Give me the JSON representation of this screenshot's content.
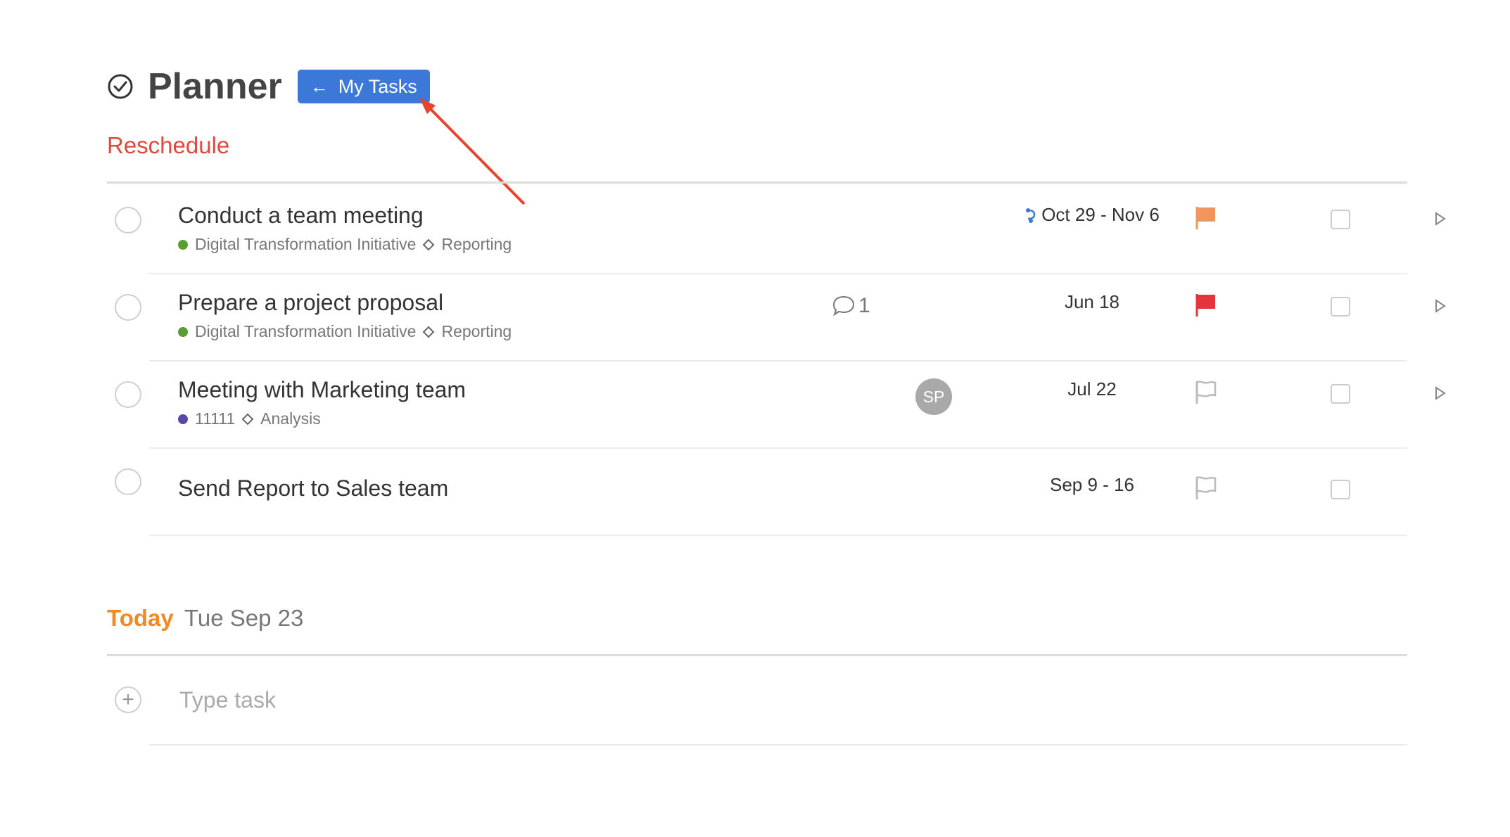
{
  "header": {
    "title": "Planner",
    "my_tasks_label": "My Tasks"
  },
  "sections": {
    "reschedule_label": "Reschedule",
    "today_label": "Today",
    "today_date": "Tue Sep 23"
  },
  "tasks": [
    {
      "name": "Conduct a team meeting",
      "project": "Digital Transformation Initiative",
      "project_color": "#5a9e32",
      "tag": "Reporting",
      "date": "Oct 29 - Nov 6",
      "date_icon": "recurring-icon",
      "flag_color": "#f0955f",
      "flag": "filled"
    },
    {
      "name": "Prepare a project proposal",
      "project": "Digital Transformation Initiative",
      "project_color": "#5a9e32",
      "tag": "Reporting",
      "comment_count": "1",
      "date": "Jun 18",
      "flag_color": "#e2353c",
      "flag": "filled"
    },
    {
      "name": "Meeting with Marketing team",
      "project": "11111",
      "project_color": "#5b46a8",
      "tag": "Analysis",
      "assignee_initials": "SP",
      "date": "Jul 22",
      "flag_color": "#bbbbbb",
      "flag": "outline"
    },
    {
      "name": "Send Report to Sales team",
      "date": "Sep 9 - 16",
      "flag_color": "#bbbbbb",
      "flag": "outline"
    }
  ],
  "new_task": {
    "placeholder": "Type task"
  },
  "colors": {
    "accent_blue": "#3c78d8",
    "reschedule_red": "#db4c3f",
    "today_orange": "#f08a24",
    "annotation_arrow": "#e8432e"
  }
}
